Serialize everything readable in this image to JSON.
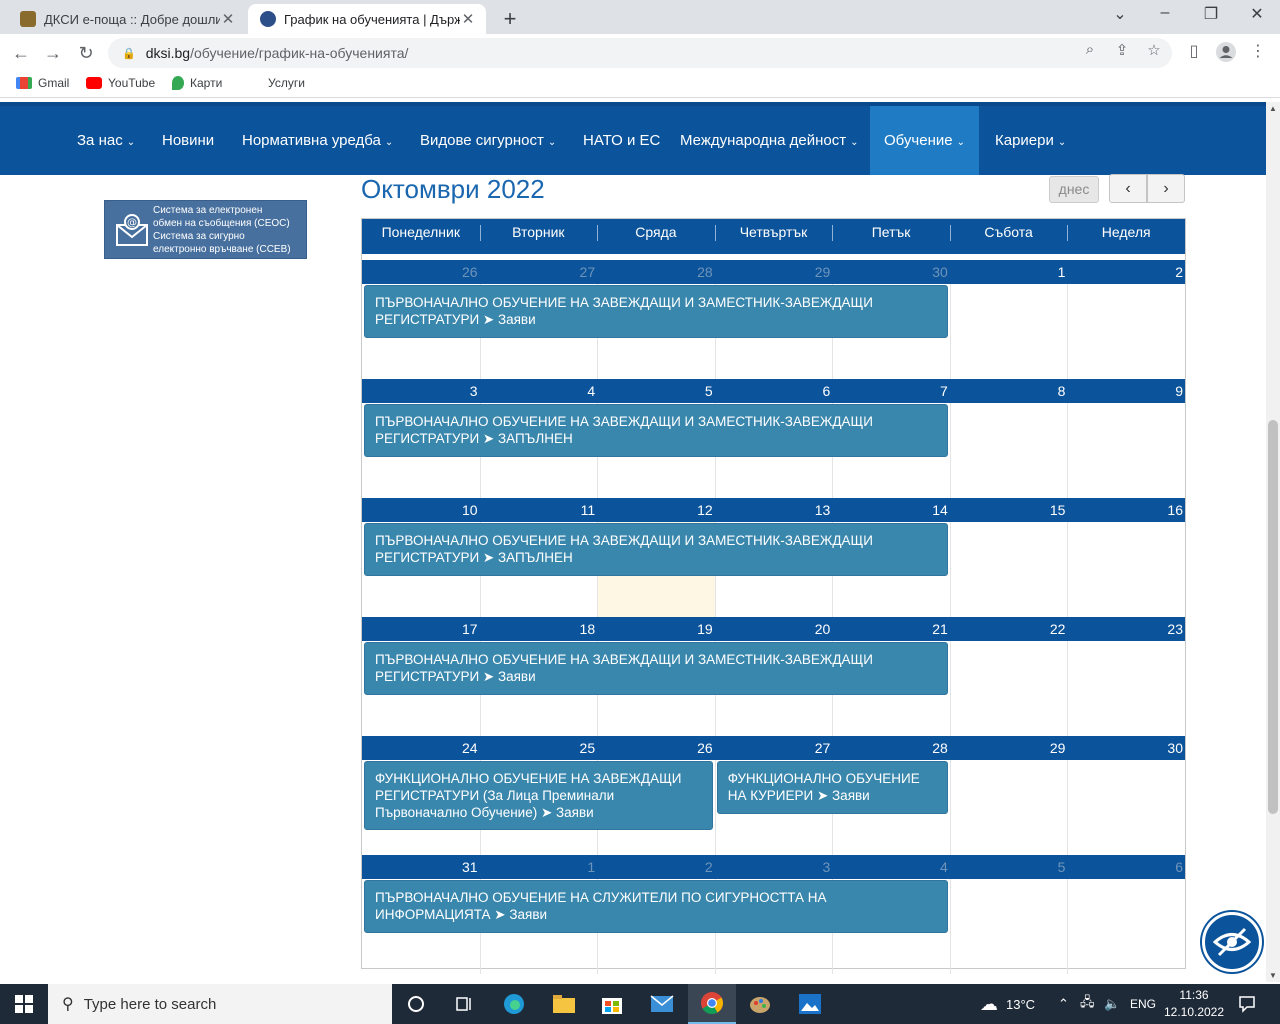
{
  "browser": {
    "tabs": [
      {
        "title": "ДКСИ е-поща :: Добре дошли в",
        "active": false
      },
      {
        "title": "График на обученията | Държа",
        "active": true
      }
    ],
    "url_host": "dksi.bg",
    "url_path": "/обучение/график-на-обученията/",
    "bookmarks": [
      "Gmail",
      "YouTube",
      "Карти",
      "Услуги"
    ]
  },
  "site_nav": {
    "items": [
      {
        "label": "За нас",
        "has_menu": true
      },
      {
        "label": "Новини",
        "has_menu": false
      },
      {
        "label": "Нормативна уредба",
        "has_menu": true
      },
      {
        "label": "Видове сигурност",
        "has_menu": true
      },
      {
        "label": "НАТО и ЕС",
        "has_menu": false
      },
      {
        "label": "Международна дейност",
        "has_menu": true
      },
      {
        "label": "Обучение",
        "has_menu": true,
        "active": true
      },
      {
        "label": "Кариери",
        "has_menu": true
      }
    ]
  },
  "banner": {
    "line1": "Система за електронен",
    "line2": "обмен на съобщения (СЕОС)",
    "line3": "Система за сигурно",
    "line4": "електронно връчване (ССЕВ)"
  },
  "calendar": {
    "title": "Октомври 2022",
    "today_label": "днес",
    "prev_label": "‹",
    "next_label": "›",
    "weekdays": [
      "Понеделник",
      "Вторник",
      "Сряда",
      "Четвъртък",
      "Петък",
      "Събота",
      "Неделя"
    ],
    "weeks": [
      {
        "days": [
          {
            "n": "26",
            "o": true
          },
          {
            "n": "27",
            "o": true
          },
          {
            "n": "28",
            "o": true
          },
          {
            "n": "29",
            "o": true
          },
          {
            "n": "30",
            "o": true
          },
          {
            "n": "1"
          },
          {
            "n": "2"
          }
        ],
        "events": [
          {
            "text": "ПЪРВОНАЧАЛНО ОБУЧЕНИЕ НА ЗАВЕЖДАЩИ И ЗАМЕСТНИК-ЗАВЕЖДАЩИ РЕГИСТРАТУРИ ➤ Заяви",
            "start": 0,
            "span": 5
          }
        ]
      },
      {
        "days": [
          {
            "n": "3"
          },
          {
            "n": "4"
          },
          {
            "n": "5"
          },
          {
            "n": "6"
          },
          {
            "n": "7"
          },
          {
            "n": "8"
          },
          {
            "n": "9"
          }
        ],
        "events": [
          {
            "text": "ПЪРВОНАЧАЛНО ОБУЧЕНИЕ НА ЗАВЕЖДАЩИ И ЗАМЕСТНИК-ЗАВЕЖДАЩИ РЕГИСТРАТУРИ ➤ ЗАПЪЛНЕН",
            "start": 0,
            "span": 5
          }
        ]
      },
      {
        "days": [
          {
            "n": "10"
          },
          {
            "n": "11"
          },
          {
            "n": "12",
            "today": true
          },
          {
            "n": "13"
          },
          {
            "n": "14"
          },
          {
            "n": "15"
          },
          {
            "n": "16"
          }
        ],
        "events": [
          {
            "text": "ПЪРВОНАЧАЛНО ОБУЧЕНИЕ НА ЗАВЕЖДАЩИ И ЗАМЕСТНИК-ЗАВЕЖДАЩИ РЕГИСТРАТУРИ ➤ ЗАПЪЛНЕН",
            "start": 0,
            "span": 5
          }
        ]
      },
      {
        "days": [
          {
            "n": "17"
          },
          {
            "n": "18"
          },
          {
            "n": "19"
          },
          {
            "n": "20"
          },
          {
            "n": "21"
          },
          {
            "n": "22"
          },
          {
            "n": "23"
          }
        ],
        "events": [
          {
            "text": "ПЪРВОНАЧАЛНО ОБУЧЕНИЕ НА ЗАВЕЖДАЩИ И ЗАМЕСТНИК-ЗАВЕЖДАЩИ РЕГИСТРАТУРИ ➤ Заяви",
            "start": 0,
            "span": 5
          }
        ]
      },
      {
        "days": [
          {
            "n": "24"
          },
          {
            "n": "25"
          },
          {
            "n": "26"
          },
          {
            "n": "27"
          },
          {
            "n": "28"
          },
          {
            "n": "29"
          },
          {
            "n": "30"
          }
        ],
        "events": [
          {
            "text": "ФУНКЦИОНАЛНО ОБУЧЕНИЕ НА ЗАВЕЖДАЩИ РЕГИСТРАТУРИ (За Лица Преминали Първоначално Обучение) ➤ Заяви",
            "start": 0,
            "span": 3
          },
          {
            "text": "ФУНКЦИОНАЛНО ОБУЧЕНИЕ НА КУРИЕРИ ➤ Заяви",
            "start": 3,
            "span": 2
          }
        ]
      },
      {
        "days": [
          {
            "n": "31"
          },
          {
            "n": "1",
            "o": true
          },
          {
            "n": "2",
            "o": true
          },
          {
            "n": "3",
            "o": true
          },
          {
            "n": "4",
            "o": true
          },
          {
            "n": "5",
            "o": true
          },
          {
            "n": "6",
            "o": true
          }
        ],
        "events": [
          {
            "text": "ПЪРВОНАЧАЛНО ОБУЧЕНИЕ НА СЛУЖИТЕЛИ ПО СИГУРНОСТТА НА ИНФОРМАЦИЯТА ➤ Заяви",
            "start": 0,
            "span": 5
          }
        ]
      }
    ]
  },
  "taskbar": {
    "search_placeholder": "Type here to search",
    "temperature": "13°C",
    "language": "ENG",
    "time": "11:36",
    "date": "12.10.2022"
  },
  "colors": {
    "nav": "#0b539a",
    "event": "#3a87ad",
    "today": "#fdf7e3"
  }
}
